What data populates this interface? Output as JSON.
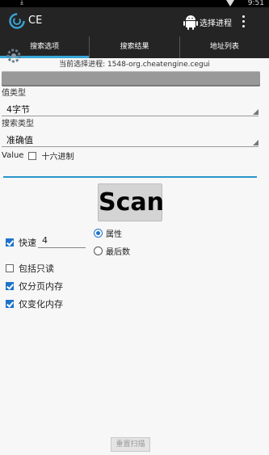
{
  "status_bar": {
    "time": "9:51",
    "download_icon": "download-icon",
    "wifi_icon": "wifi-icon"
  },
  "app_bar": {
    "title": "CE",
    "logo_icon": "cheat-engine-logo",
    "process_button_label": "选择进程",
    "process_button_icon": "android-icon",
    "menu_icon": "overflow-menu-icon"
  },
  "tabs": [
    {
      "label": "搜索选项",
      "active": true
    },
    {
      "label": "搜索结果",
      "active": false
    },
    {
      "label": "地址列表",
      "active": false
    }
  ],
  "current_process": "当前选择进程: 1548-org.cheatengine.cegui",
  "value_type": {
    "label": "值类型",
    "selected": "4字节"
  },
  "scan_type": {
    "label": "搜索类型",
    "selected": "准确值"
  },
  "value": {
    "label": "Value",
    "hex_label": "十六进制",
    "hex_checked": false,
    "input_value": ""
  },
  "scan_button_label": "Scan",
  "options": {
    "fast": {
      "label": "快速",
      "checked": true,
      "value": "4"
    },
    "alignment_radio": [
      {
        "label": "属性",
        "checked": true
      },
      {
        "label": "最后数",
        "checked": false
      }
    ],
    "include_readonly": {
      "label": "包括只读",
      "checked": false
    },
    "paged_memory_only": {
      "label": "仅分页内存",
      "checked": true
    },
    "changed_memory_only": {
      "label": "仅变化内存",
      "checked": true
    }
  },
  "reset_scan_label": "重置扫描",
  "colors": {
    "accent": "#35a7d6",
    "checkbox": "#1e73c9",
    "toolbar": "#242424"
  }
}
